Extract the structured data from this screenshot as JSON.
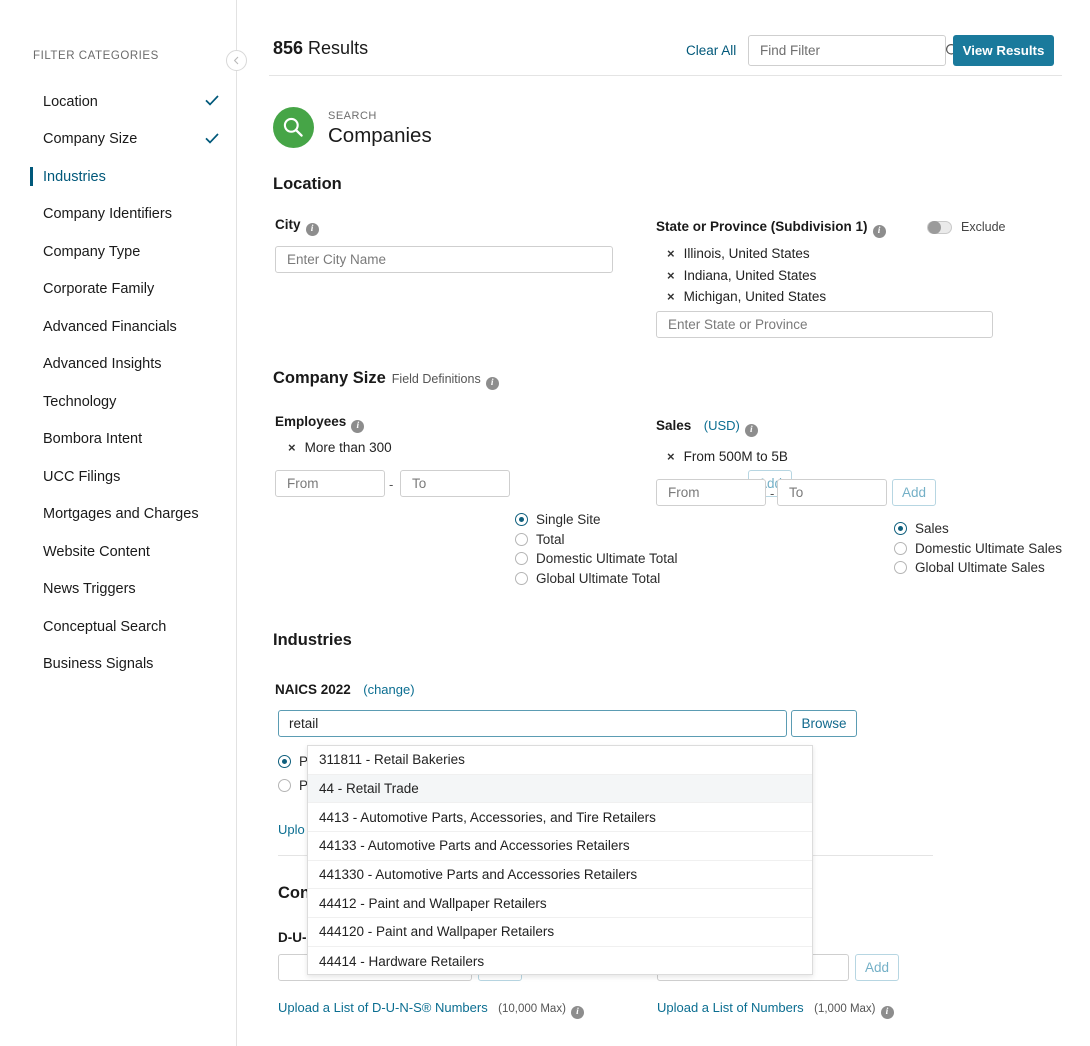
{
  "sidebar": {
    "title": "FILTER CATEGORIES",
    "collapse_icon": "chevron-left-icon",
    "items": [
      {
        "label": "Location",
        "checked": true,
        "active": false
      },
      {
        "label": "Company Size",
        "checked": true,
        "active": false
      },
      {
        "label": "Industries",
        "checked": false,
        "active": true
      },
      {
        "label": "Company Identifiers",
        "checked": false,
        "active": false
      },
      {
        "label": "Company Type",
        "checked": false,
        "active": false
      },
      {
        "label": "Corporate Family",
        "checked": false,
        "active": false
      },
      {
        "label": "Advanced Financials",
        "checked": false,
        "active": false
      },
      {
        "label": "Advanced Insights",
        "checked": false,
        "active": false
      },
      {
        "label": "Technology",
        "checked": false,
        "active": false
      },
      {
        "label": "Bombora Intent",
        "checked": false,
        "active": false
      },
      {
        "label": "UCC Filings",
        "checked": false,
        "active": false
      },
      {
        "label": "Mortgages and Charges",
        "checked": false,
        "active": false
      },
      {
        "label": "Website Content",
        "checked": false,
        "active": false
      },
      {
        "label": "News Triggers",
        "checked": false,
        "active": false
      },
      {
        "label": "Conceptual Search",
        "checked": false,
        "active": false
      },
      {
        "label": "Business Signals",
        "checked": false,
        "active": false
      }
    ]
  },
  "topbar": {
    "results_number": "856",
    "results_word": " Results",
    "clear_all": "Clear All",
    "find_filter_placeholder": "Find Filter",
    "find_filter_value": "",
    "search_icon": "search-icon",
    "view_results": "View Results",
    "accent_color": "#1a7a9c"
  },
  "search_header": {
    "kicker": "SEARCH",
    "title": "Companies",
    "icon": "search-icon",
    "icon_color": "#46a547"
  },
  "location": {
    "heading": "Location",
    "city": {
      "label": "City",
      "info_icon": "info-icon",
      "placeholder": "Enter City Name",
      "value": ""
    },
    "state": {
      "label": "State or Province (Subdivision 1)",
      "info_icon": "info-icon",
      "placeholder": "Enter State or Province",
      "value": "",
      "chips": [
        "Illinois, United States",
        "Indiana, United States",
        "Michigan, United States"
      ]
    },
    "exclude": {
      "label": "Exclude",
      "on": false
    }
  },
  "company_size": {
    "heading": "Company Size",
    "field_definitions": "Field Definitions",
    "info_icon": "info-icon",
    "employees": {
      "label": "Employees",
      "chips": [
        "More than 300"
      ],
      "from_placeholder": "From",
      "to_placeholder": "To",
      "separator": "-",
      "add_label": "Add",
      "options": [
        "Single Site",
        "Total",
        "Domestic Ultimate Total",
        "Global Ultimate Total"
      ],
      "selected": "Single Site"
    },
    "sales": {
      "label": "Sales",
      "currency": "(USD)",
      "chips": [
        "From 500M to 5B"
      ],
      "from_placeholder": "From",
      "to_placeholder": "To",
      "separator": "-",
      "add_label": "Add",
      "options": [
        "Sales",
        "Domestic Ultimate Sales",
        "Global Ultimate Sales"
      ],
      "selected": "Sales"
    }
  },
  "industries": {
    "heading": "Industries",
    "naics_label": "NAICS 2022",
    "change_link": "(change)",
    "input_value": "retail",
    "browse_label": "Browse",
    "radio_options": [
      "P",
      "P"
    ],
    "selected_radio": 0,
    "upload_link_partial": "Uplo",
    "dropdown": [
      {
        "label": "311811 - Retail Bakeries",
        "highlighted": false
      },
      {
        "label": "44 - Retail Trade",
        "highlighted": true
      },
      {
        "label": "4413 - Automotive Parts, Accessories, and Tire Retailers",
        "highlighted": false
      },
      {
        "label": "44133 - Automotive Parts and Accessories Retailers",
        "highlighted": false
      },
      {
        "label": "441330 - Automotive Parts and Accessories Retailers",
        "highlighted": false
      },
      {
        "label": "44412 - Paint and Wallpaper Retailers",
        "highlighted": false
      },
      {
        "label": "444120 - Paint and Wallpaper Retailers",
        "highlighted": false
      },
      {
        "label": "44414 - Hardware Retailers",
        "highlighted": false
      }
    ]
  },
  "company_identifiers": {
    "heading_partial": "Con",
    "duns_label_partial": "D-U-",
    "duns_input_value": "",
    "numbers_input_value": "",
    "add_label": "Add",
    "upload_duns": {
      "link": "Upload a List of D-U-N-S® Numbers",
      "max": "(10,000 Max)",
      "info_icon": "info-icon"
    },
    "upload_numbers": {
      "link": "Upload a List of Numbers",
      "max": "(1,000 Max)",
      "info_icon": "info-icon"
    }
  }
}
